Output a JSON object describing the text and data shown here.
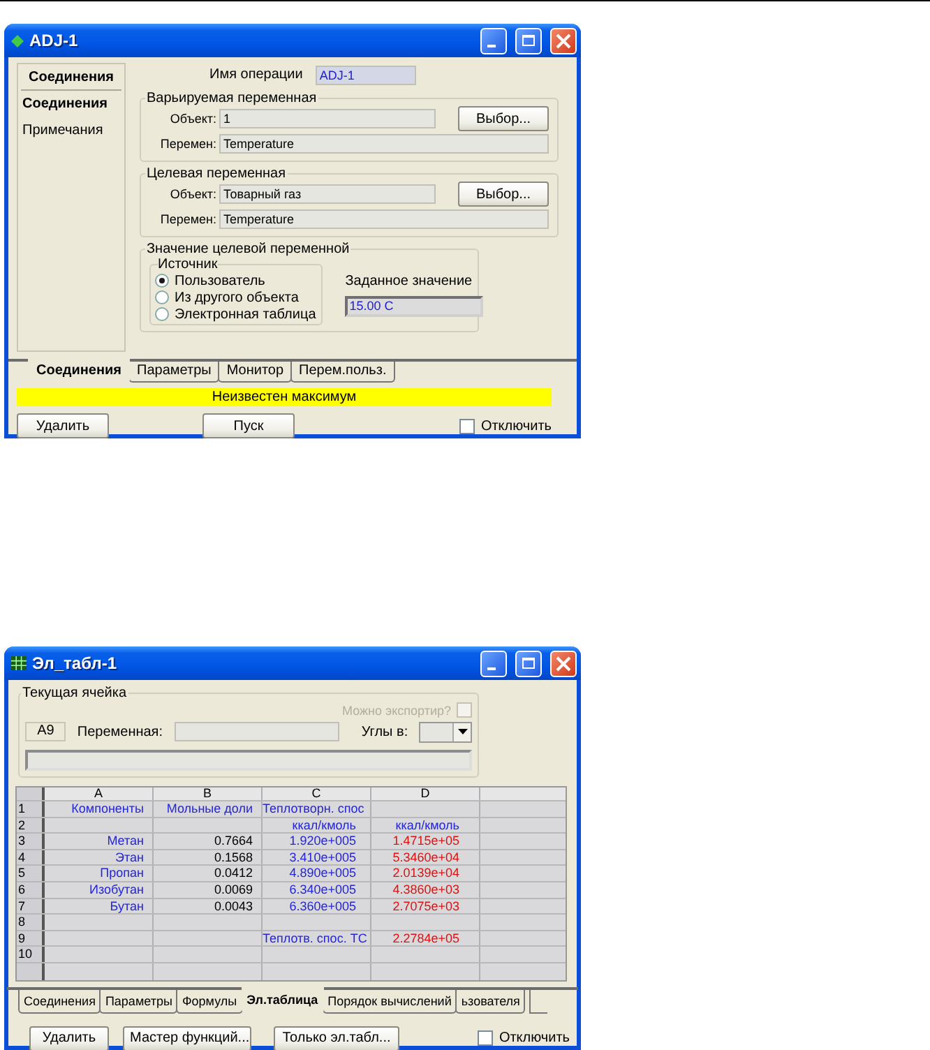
{
  "adjust_window": {
    "title": "ADJ-1",
    "sidebar": {
      "header": "Соединения",
      "items": [
        {
          "label": "Соединения",
          "selected": true
        },
        {
          "label": "Примечания",
          "selected": false
        }
      ]
    },
    "operation_name": {
      "label": "Имя операции",
      "value": "ADJ-1"
    },
    "groups": [
      {
        "title": "Варьируемая переменная",
        "object_label": "Объект:",
        "object_value": "1",
        "choose_button": "Выбор...",
        "variable_label": "Перемен:",
        "variable_value": "Temperature"
      },
      {
        "title": "Целевая переменная",
        "object_label": "Объект:",
        "object_value": "Товарный газ",
        "choose_button": "Выбор...",
        "variable_label": "Перемен:",
        "variable_value": "Temperature"
      }
    ],
    "target_value": {
      "title": "Значение целевой переменной",
      "source": {
        "title": "Источник",
        "options": [
          {
            "label": "Пользователь",
            "selected": true
          },
          {
            "label": "Из другого объекта",
            "selected": false
          },
          {
            "label": "Электронная таблица",
            "selected": false
          }
        ]
      },
      "setpoint_label": "Заданное значение",
      "setpoint_value": "15.00 C"
    },
    "tabs": [
      {
        "label": "Соединения",
        "selected": true
      },
      {
        "label": "Параметры",
        "selected": false
      },
      {
        "label": "Монитор",
        "selected": false
      },
      {
        "label": "Перем.польз.",
        "selected": false
      }
    ],
    "status": "Неизвестен максимум",
    "buttons": [
      "Удалить",
      "Пуск"
    ],
    "disable_checkbox": {
      "label": "Отключить",
      "checked": false
    }
  },
  "spreadsheet_window": {
    "title": "Эл_табл-1",
    "current_cell": {
      "title": "Текущая ячейка",
      "export_label": "Можно экспортир?",
      "export_checked": false,
      "cell_ref": "A9",
      "variable_label": "Переменная:",
      "angles_label": "Углы в:"
    },
    "columns": [
      "A",
      "B",
      "C",
      "D"
    ],
    "rows": [
      {
        "number": "1",
        "cells": [
          {
            "text": "Компоненты",
            "kind": "text"
          },
          {
            "text": "Мольные доли",
            "kind": "text"
          },
          {
            "text": "Теплотворн. спос",
            "kind": "text"
          },
          null
        ]
      },
      {
        "number": "2",
        "cells": [
          null,
          null,
          {
            "text": "ккал/кмоль",
            "kind": "text"
          },
          {
            "text": "ккал/кмоль",
            "kind": "text"
          }
        ]
      },
      {
        "number": "3",
        "cells": [
          {
            "text": "Метан",
            "kind": "text"
          },
          {
            "text": "0.7664",
            "kind": "number"
          },
          {
            "text": "1.920e+005",
            "kind": "input"
          },
          {
            "text": "1.4715e+05",
            "kind": "result"
          }
        ]
      },
      {
        "number": "4",
        "cells": [
          {
            "text": "Этан",
            "kind": "text"
          },
          {
            "text": "0.1568",
            "kind": "number"
          },
          {
            "text": "3.410e+005",
            "kind": "input"
          },
          {
            "text": "5.3460e+04",
            "kind": "result"
          }
        ]
      },
      {
        "number": "5",
        "cells": [
          {
            "text": "Пропан",
            "kind": "text"
          },
          {
            "text": "0.0412",
            "kind": "number"
          },
          {
            "text": "4.890e+005",
            "kind": "input"
          },
          {
            "text": "2.0139e+04",
            "kind": "result"
          }
        ]
      },
      {
        "number": "6",
        "cells": [
          {
            "text": "Изобутан",
            "kind": "text"
          },
          {
            "text": "0.0069",
            "kind": "number"
          },
          {
            "text": "6.340e+005",
            "kind": "input"
          },
          {
            "text": "4.3860e+03",
            "kind": "result"
          }
        ]
      },
      {
        "number": "7",
        "cells": [
          {
            "text": "Бутан",
            "kind": "text"
          },
          {
            "text": "0.0043",
            "kind": "number"
          },
          {
            "text": "6.360e+005",
            "kind": "input"
          },
          {
            "text": "2.7075e+03",
            "kind": "result"
          }
        ]
      },
      {
        "number": "8",
        "cells": [
          null,
          null,
          null,
          null
        ]
      },
      {
        "number": "9",
        "cells": [
          null,
          null,
          {
            "text": "Теплотв. спос. ТС",
            "kind": "text"
          },
          {
            "text": "2.2784e+05",
            "kind": "result"
          }
        ]
      },
      {
        "number": "10",
        "cells": [
          null,
          null,
          null,
          null
        ]
      }
    ],
    "tabs": [
      {
        "label": "Соединения",
        "selected": false
      },
      {
        "label": "Параметры",
        "selected": false
      },
      {
        "label": "Формулы",
        "selected": false
      },
      {
        "label": "Эл.таблица",
        "selected": true
      },
      {
        "label": "Порядок вычислений",
        "selected": false
      },
      {
        "label": "ьзователя",
        "selected": false
      }
    ],
    "buttons": [
      "Удалить",
      "Мастер функций...",
      "Только эл.табл..."
    ],
    "disable_checkbox": {
      "label": "Отключить",
      "checked": false
    }
  }
}
